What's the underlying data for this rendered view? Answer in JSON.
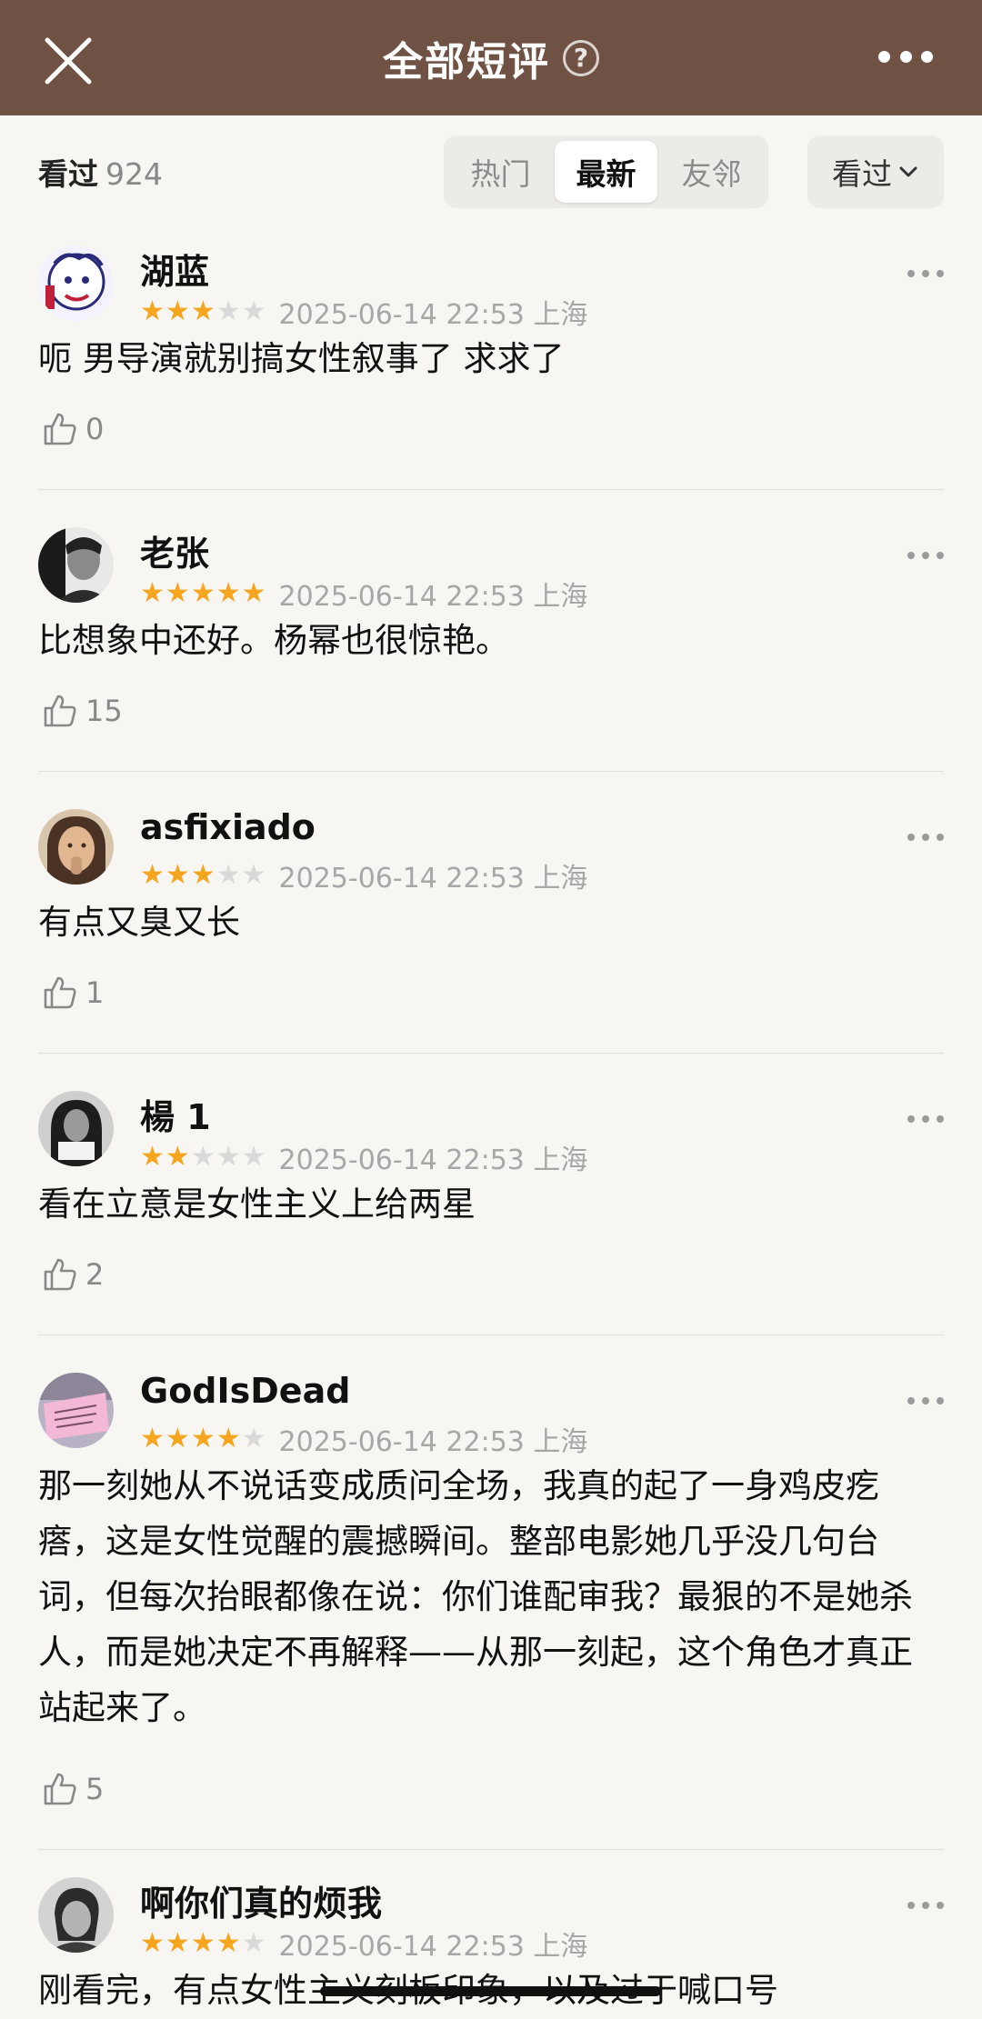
{
  "header": {
    "title": "全部短评",
    "help_glyph": "?",
    "close_icon": "close-icon",
    "more_icon": "more-icon"
  },
  "filters": {
    "count_label": "看过",
    "count_value": "924",
    "tabs": [
      "热门",
      "最新",
      "友邻"
    ],
    "active_tab": "最新",
    "seen_dropdown": "看过"
  },
  "reviews": [
    {
      "name": "湖蓝",
      "rating": 3,
      "time": "2025-06-14 22:53 上海",
      "content": "呃 男导演就别搞女性叙事了 求求了",
      "likes": "0"
    },
    {
      "name": "老张",
      "rating": 5,
      "time": "2025-06-14 22:53 上海",
      "content": "比想象中还好。杨幂也很惊艳。",
      "likes": "15"
    },
    {
      "name": "asfixiado",
      "rating": 3,
      "time": "2025-06-14 22:53 上海",
      "content": "有点又臭又长",
      "likes": "1"
    },
    {
      "name": "楊 1",
      "rating": 2,
      "time": "2025-06-14 22:53 上海",
      "content": "看在立意是女性主义上给两星",
      "likes": "2"
    },
    {
      "name": "GodIsDead",
      "rating": 4,
      "time": "2025-06-14 22:53 上海",
      "content": "那一刻她从不说话变成质问全场，我真的起了一身鸡皮疙瘩，这是女性觉醒的震撼瞬间。整部电影她几乎没几句台词，但每次抬眼都像在说：你们谁配审我？最狠的不是她杀人，而是她决定不再解释——从那一刻起，这个角色才真正站起来了。",
      "likes": "5"
    },
    {
      "name": "啊你们真的烦我",
      "rating": 4,
      "time": "2025-06-14 22:53 上海",
      "content": "刚看完，有点女性主义刻板印象，以及过于喊口号",
      "likes": ""
    }
  ],
  "colors": {
    "header_bg": "#6f5244",
    "star_on": "#f6a51e",
    "star_off": "#d9d9d9"
  }
}
